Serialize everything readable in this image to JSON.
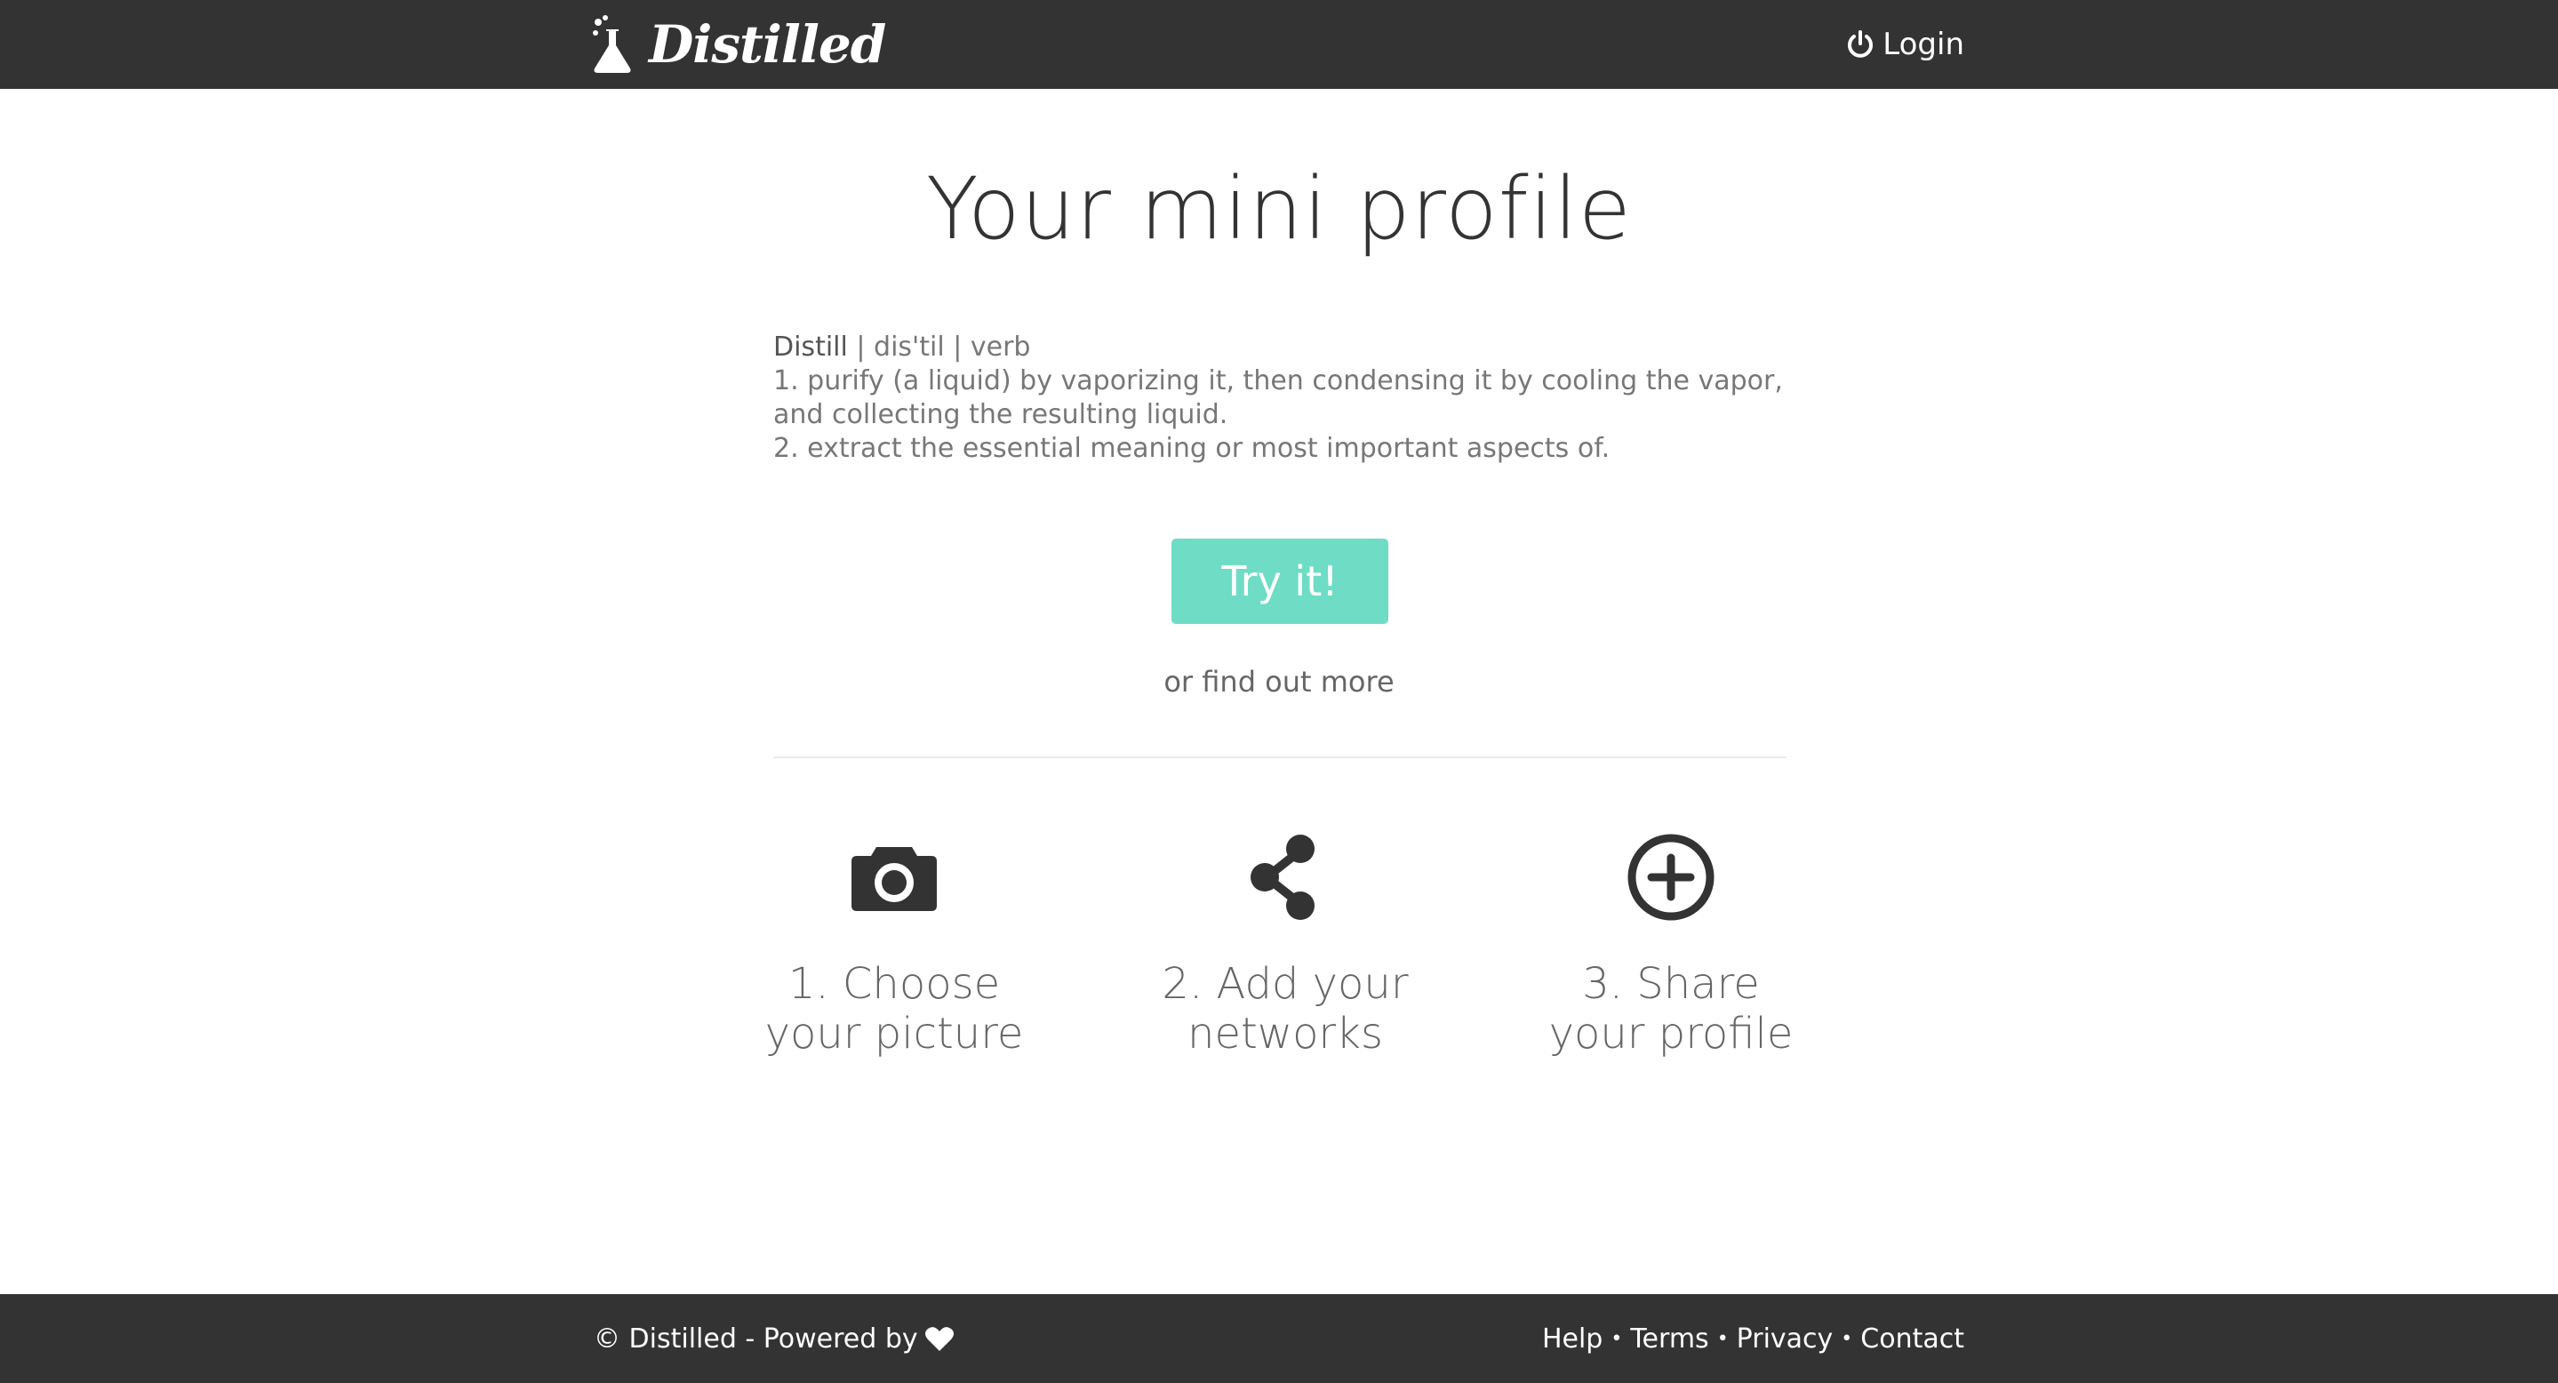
{
  "header": {
    "brand_name": "Distilled",
    "brand_icon": "flask-icon",
    "login_label": "Login",
    "login_icon": "power-icon",
    "background_color": "#333333"
  },
  "main": {
    "title": "Your mini profile",
    "definition": {
      "word": "Distill",
      "pronunciation": " | dis'til | verb",
      "line1": "1. purify (a liquid) by vaporizing it, then condensing it by cooling the vapor,",
      "line2": "and collecting the resulting liquid.",
      "line3": "2. extract the essential meaning or most important aspects of."
    },
    "cta_label": "Try it!",
    "cta_color": "#6fdcc5",
    "find_more_label": "or find out more",
    "steps": [
      {
        "icon": "camera-icon",
        "line1": "1. Choose",
        "line2": "your picture"
      },
      {
        "icon": "share-icon",
        "line1": "2. Add your",
        "line2": "networks"
      },
      {
        "icon": "plus-circle-icon",
        "line1": "3. Share",
        "line2": "your profile"
      }
    ]
  },
  "footer": {
    "copyright_text": "© Distilled - Powered by",
    "heart_icon": "heart-icon",
    "links": [
      "Help",
      "Terms",
      "Privacy",
      "Contact"
    ],
    "separator": "•"
  }
}
